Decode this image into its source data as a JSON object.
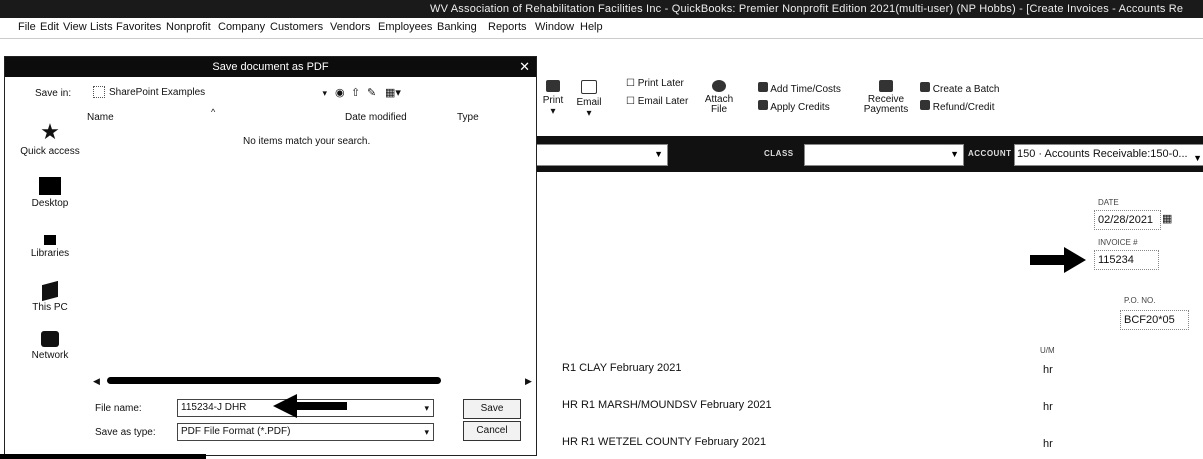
{
  "window": {
    "title": "WV Association of Rehabilitation Facilities Inc  - QuickBooks: Premier Nonprofit Edition 2021(multi-user) (NP Hobbs) - [Create Invoices - Accounts Re"
  },
  "menu": [
    "File",
    "Edit",
    "View",
    "Lists",
    "Favorites",
    "Nonprofit",
    "Company",
    "Customers",
    "Vendors",
    "Employees",
    "Banking",
    "Reports",
    "Window",
    "Help"
  ],
  "toolbar": {
    "print": "Print",
    "email": "Email",
    "print_later": "Print Later",
    "email_later": "Email Later",
    "attach_file": "Attach File",
    "add_time_costs": "Add Time/Costs",
    "apply_credits": "Apply Credits",
    "receive_payments": "Receive Payments",
    "create_batch": "Create a Batch",
    "refund_credit": "Refund/Credit"
  },
  "strip": {
    "class_label": "CLASS",
    "account_label": "ACCOUNT",
    "account_value": "150 · Accounts Receivable:150-0..."
  },
  "invoice": {
    "date_label": "DATE",
    "date_value": "02/28/2021",
    "invoice_label": "INVOICE #",
    "invoice_value": "115234",
    "po_label": "P.O. NO.",
    "po_value": "BCF20*05",
    "um_header": "U/M"
  },
  "lines": [
    {
      "desc": "R1 CLAY February 2021",
      "um": "hr"
    },
    {
      "desc": "HR R1 MARSH/MOUNDSV February 2021",
      "um": "hr"
    },
    {
      "desc": "HR R1 WETZEL COUNTY February 2021",
      "um": "hr"
    }
  ],
  "dialog": {
    "title": "Save document as PDF",
    "save_in_label": "Save in:",
    "save_in_value": "SharePoint Examples",
    "col_name": "Name",
    "col_date": "Date modified",
    "col_type": "Type",
    "empty_msg": "No items match your search.",
    "nav": [
      "Quick access",
      "Desktop",
      "Libraries",
      "This PC",
      "Network"
    ],
    "file_name_label": "File name:",
    "file_name_value": "115234-J DHR",
    "save_type_label": "Save as type:",
    "save_type_value": "PDF File Format (*.PDF)",
    "save_btn": "Save",
    "cancel_btn": "Cancel"
  }
}
